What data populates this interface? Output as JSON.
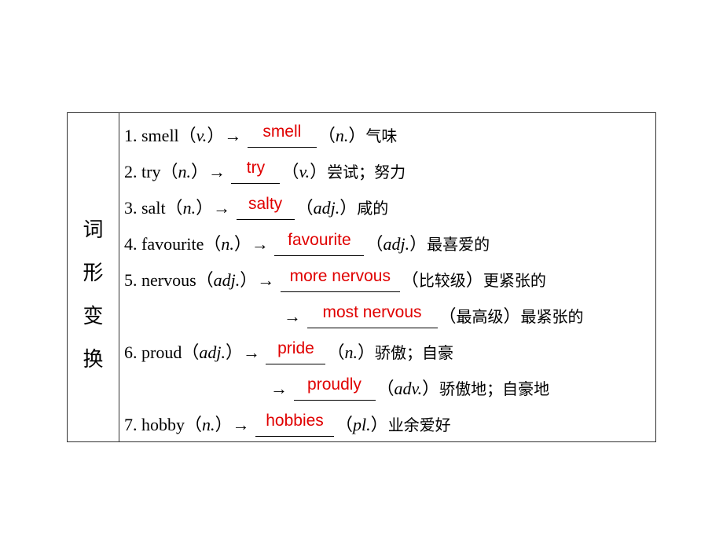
{
  "side_label": [
    "词",
    "形",
    "变",
    "换"
  ],
  "items": [
    {
      "prefix": "1. smell（",
      "pos1": "v.",
      "mid": "）→",
      "answer": "smell",
      "open": "（",
      "pos2": "n.",
      "close": "）",
      "meaning": "气味"
    },
    {
      "prefix": "2. try（",
      "pos1": "n.",
      "mid": "）→",
      "answer": "try",
      "open": "（",
      "pos2": "v.",
      "close": "）",
      "meaning": "尝试；努力"
    },
    {
      "prefix": "3. salt（",
      "pos1": "n.",
      "mid": "）→",
      "answer": "salty",
      "open": "（",
      "pos2": "adj.",
      "close": "）",
      "meaning": "咸的"
    },
    {
      "prefix": "4. favourite（",
      "pos1": "n.",
      "mid": "）→",
      "answer": "favourite",
      "open": "（",
      "pos2": "adj.",
      "close": "）",
      "meaning": "最喜爱的"
    },
    {
      "prefix": "5. nervous（",
      "pos1": "adj.",
      "mid": "）→",
      "answer": "more nervous",
      "open": "（",
      "pos2": "比较级",
      "close": "）",
      "meaning": "更紧张的"
    },
    {
      "prefix": "",
      "pos1": "",
      "mid": "→",
      "answer": "most nervous",
      "open": "（",
      "pos2": "最高级",
      "close": "）",
      "meaning": "最紧张的"
    },
    {
      "prefix": "6. proud（",
      "pos1": "adj.",
      "mid": "）→",
      "answer": "pride",
      "open": "（",
      "pos2": "n.",
      "close": "）",
      "meaning": "骄傲；自豪"
    },
    {
      "prefix": "",
      "pos1": "",
      "mid": "→",
      "answer": "proudly",
      "open": "（",
      "pos2": "adv.",
      "close": "）",
      "meaning": "骄傲地；自豪地"
    },
    {
      "prefix": "7. hobby（",
      "pos1": "n.",
      "mid": "）→",
      "answer": "hobbies",
      "open": "（",
      "pos2": "pl.",
      "close": "）",
      "meaning": "业余爱好"
    }
  ]
}
